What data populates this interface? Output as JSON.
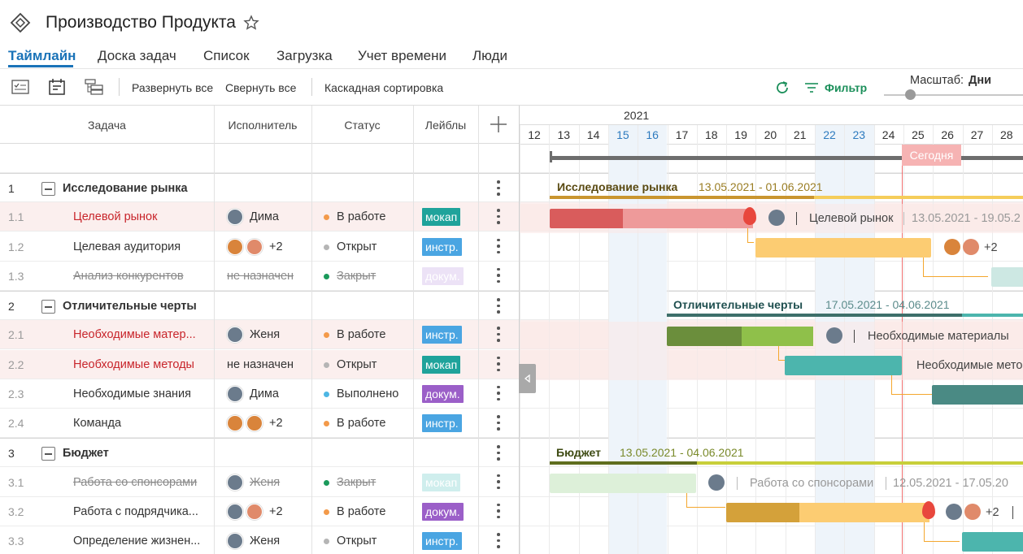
{
  "project": {
    "title": "Производство Продукта"
  },
  "tabs": [
    "Таймлайн",
    "Доска задач",
    "Список",
    "Загрузка",
    "Учет времени",
    "Люди"
  ],
  "toolbar": {
    "expand_all": "Развернуть все",
    "collapse_all": "Свернуть все",
    "cascade_sort": "Каскадная сортировка",
    "filter": "Фильтр",
    "scale_label": "Масштаб:",
    "scale_value": "Дни"
  },
  "columns": {
    "task": "Задача",
    "assignee": "Исполнитель",
    "status": "Статус",
    "labels": "Лейблы"
  },
  "timeline": {
    "year": "2021",
    "today": "Сегодня",
    "days": [
      "12",
      "13",
      "14",
      "15",
      "16",
      "17",
      "18",
      "19",
      "20",
      "21",
      "22",
      "23",
      "24",
      "25",
      "26",
      "27",
      "28"
    ]
  },
  "rows": [
    {
      "num": "1",
      "name": "Исследование рынка",
      "group": true
    },
    {
      "num": "1.1",
      "name": "Целевой рынок",
      "assignee": "Дима",
      "status": "В работе",
      "label": "мокап"
    },
    {
      "num": "1.2",
      "name": "Целевая аудитория",
      "assignee": "+2",
      "status": "Открыт",
      "label": "инстр."
    },
    {
      "num": "1.3",
      "name": "Анализ конкурентов",
      "assignee": "не назначен",
      "status": "Закрыт",
      "label": "докум."
    },
    {
      "num": "2",
      "name": "Отличительные черты",
      "group": true
    },
    {
      "num": "2.1",
      "name": "Необходимые матер...",
      "assignee": "Женя",
      "status": "В работе",
      "label": "инстр."
    },
    {
      "num": "2.2",
      "name": "Необходимые методы",
      "assignee": "не назначен",
      "status": "Открыт",
      "label": "мокап"
    },
    {
      "num": "2.3",
      "name": "Необходимые знания",
      "assignee": "Дима",
      "status": "Выполнено",
      "label": "докум."
    },
    {
      "num": "2.4",
      "name": "Команда",
      "assignee": "+2",
      "status": "В работе",
      "label": "инстр."
    },
    {
      "num": "3",
      "name": "Бюджет",
      "group": true
    },
    {
      "num": "3.1",
      "name": "Работа со спонсорами",
      "assignee": "Женя",
      "status": "Закрыт",
      "label": "мокап"
    },
    {
      "num": "3.2",
      "name": "Работа с подрядчика...",
      "assignee": "+2",
      "status": "В работе",
      "label": "докум."
    },
    {
      "num": "3.3",
      "name": "Определение жизнен...",
      "assignee": "Женя",
      "status": "Открыт",
      "label": "инстр."
    }
  ],
  "gantt": {
    "g1_title": "Исследование рынка",
    "g1_dates": "13.05.2021 - 01.06.2021",
    "t11_name": "Целевой рынок",
    "t11_dates": "13.05.2021 - 19.05.2",
    "t12_more": "+2",
    "g2_title": "Отличительные черты",
    "g2_dates": "17.05.2021 - 04.06.2021",
    "t21_name": "Необходимые материалы",
    "t22_name": "Необходимые мето",
    "g3_title": "Бюджет",
    "g3_dates": "13.05.2021 - 04.06.2021",
    "t31_name": "Работа со спонсорами",
    "t31_dates": "12.05.2021 - 17.05.20",
    "t32_more": "+2"
  },
  "colors": {
    "accent": "#1a73b8",
    "green": "#1b8f5a",
    "today": "#f06f6f"
  }
}
